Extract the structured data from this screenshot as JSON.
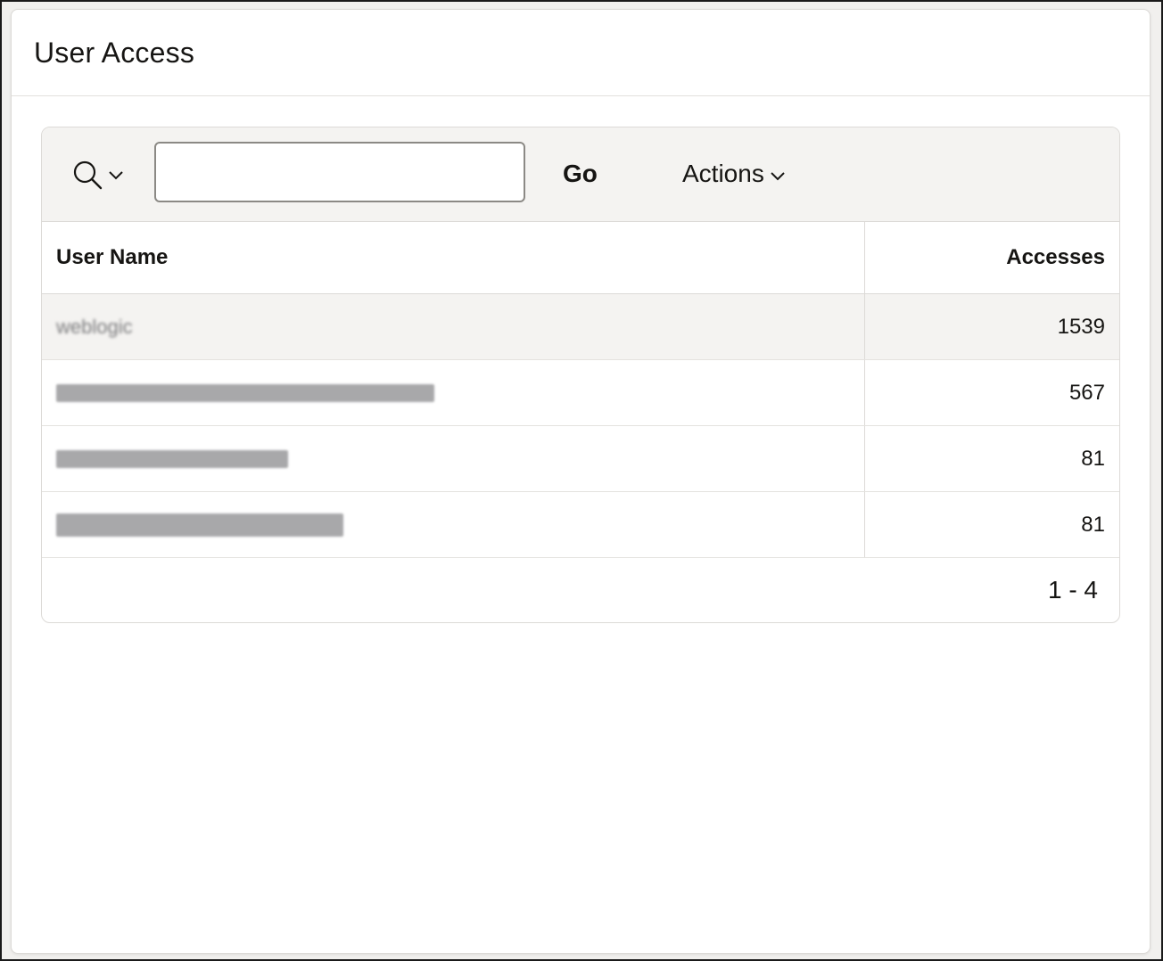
{
  "panel": {
    "title": "User Access"
  },
  "toolbar": {
    "search_icon": "search-icon",
    "chevron_icon": "chevron-down-icon",
    "search_value": "",
    "go_label": "Go",
    "actions_label": "Actions"
  },
  "table": {
    "columns": [
      "User Name",
      "Accesses"
    ],
    "rows": [
      {
        "user": "weblogic",
        "accesses": "1539",
        "masked": false
      },
      {
        "user": "xxxxxxxxxxxxxxxxxxxxxxxxxxxxxxxx",
        "accesses": "567",
        "masked": true
      },
      {
        "user": "xxxxxxxxxxxxxxxxxxx",
        "accesses": "81",
        "masked": true
      },
      {
        "user": "xxxxxxxxxxxxxxxxxxxxxxxx",
        "accesses": "81",
        "masked": true
      }
    ]
  },
  "pagination": {
    "range": "1 - 4"
  },
  "colors": {
    "toolbar_bg": "#f4f3f1",
    "border": "#dcdad7",
    "text": "#161513",
    "redaction": "#a8a8aa"
  }
}
